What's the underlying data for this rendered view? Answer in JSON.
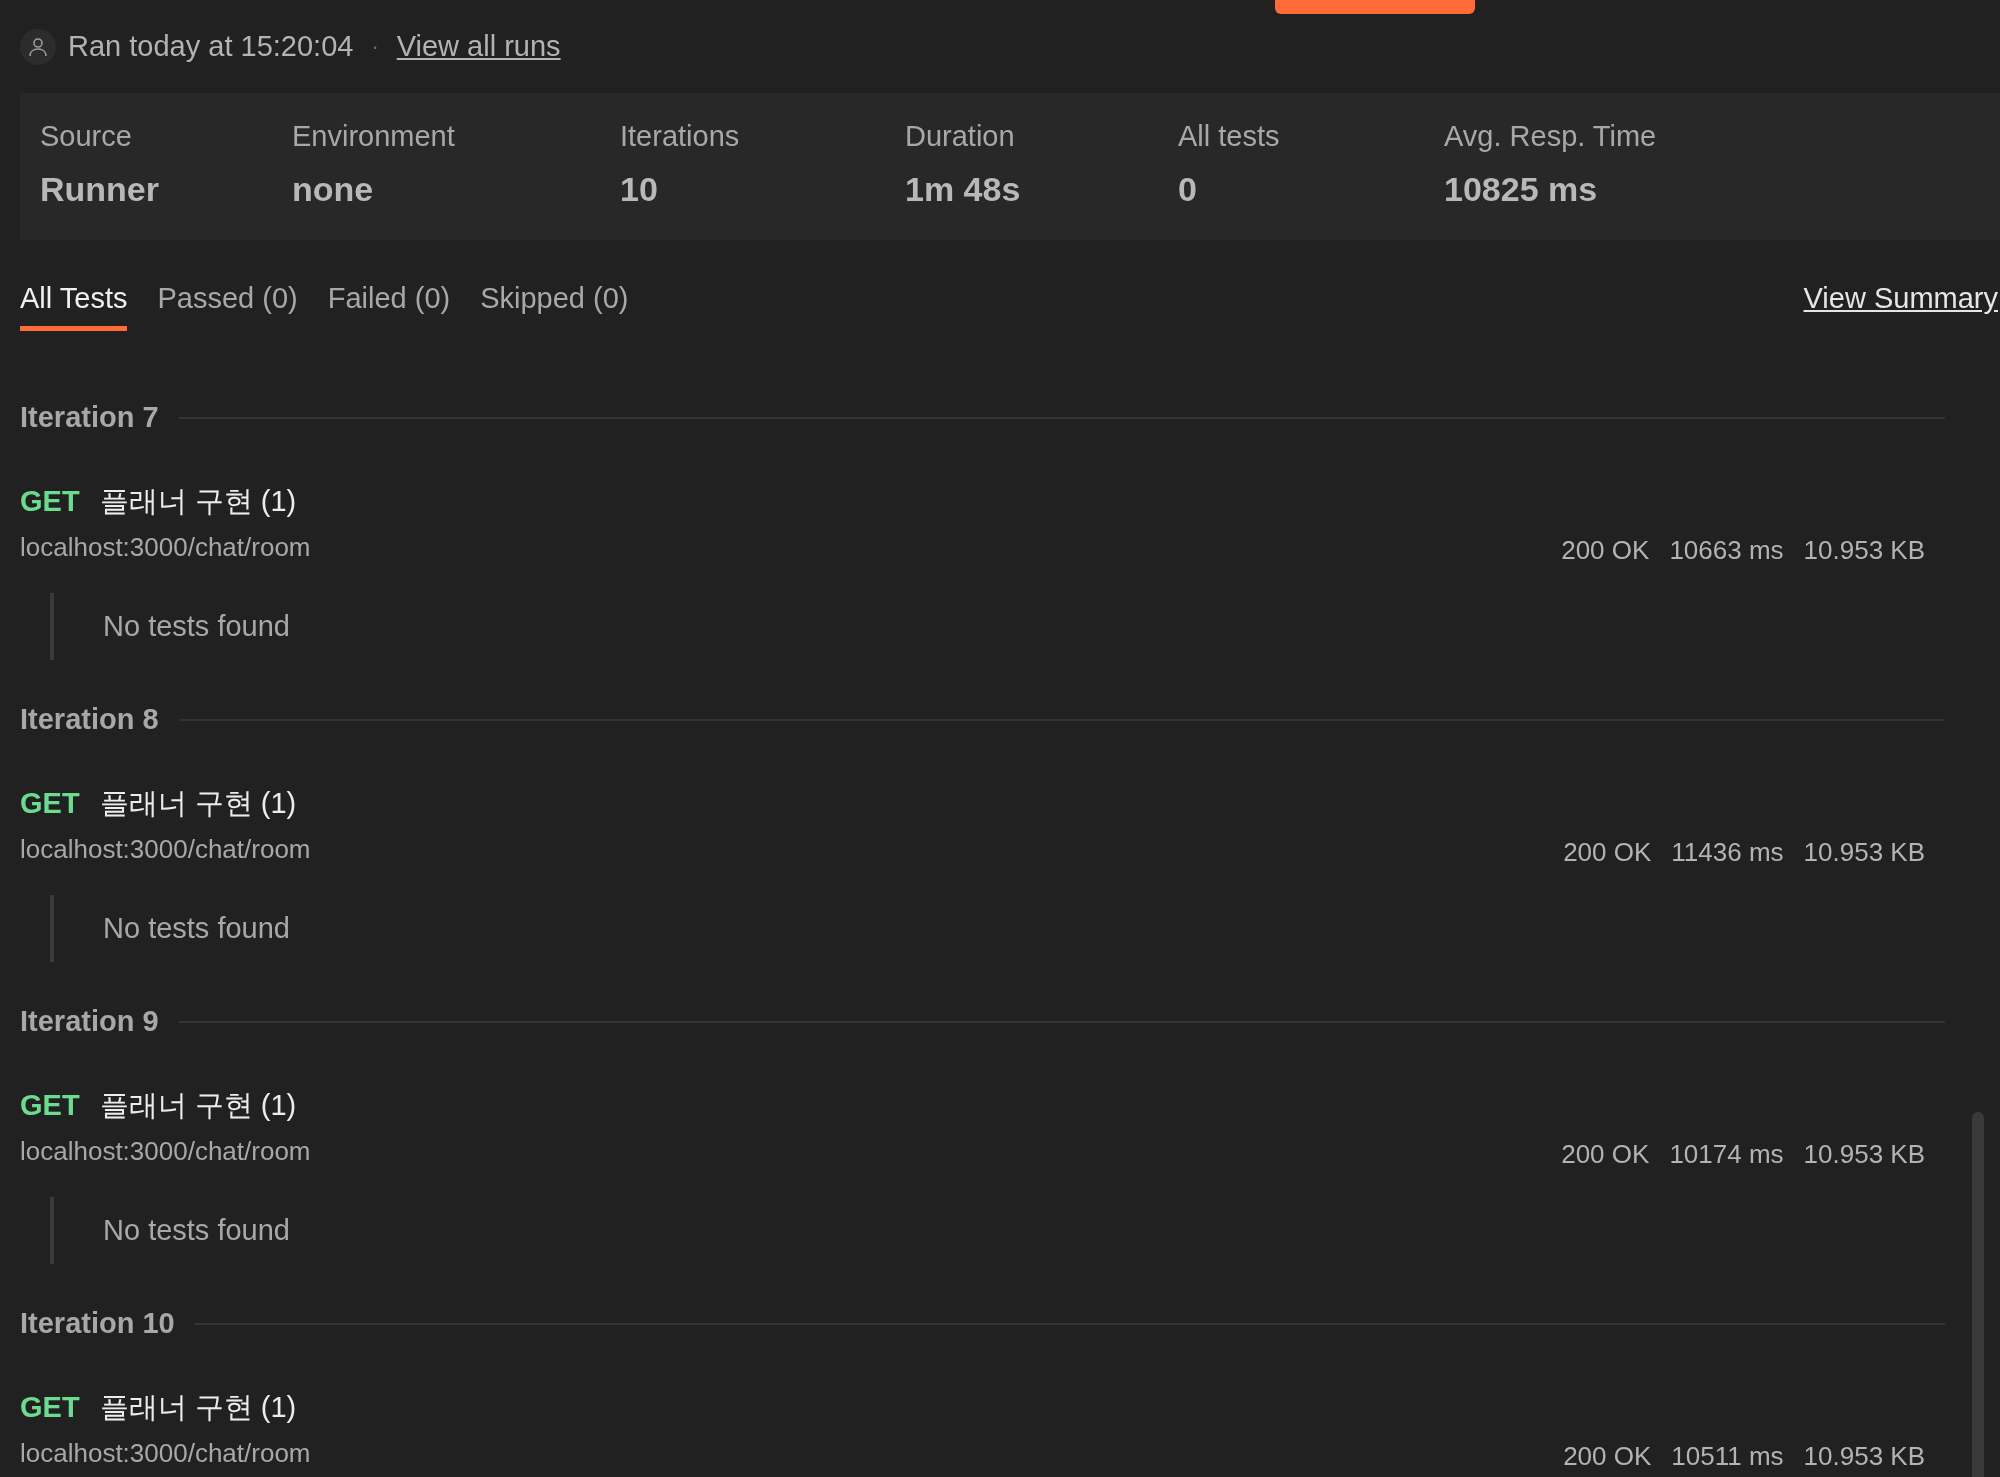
{
  "run": {
    "text": "Ran today at 15:20:04",
    "separator": "·",
    "link": "View all runs"
  },
  "summary": [
    {
      "label": "Source",
      "value": "Runner"
    },
    {
      "label": "Environment",
      "value": "none"
    },
    {
      "label": "Iterations",
      "value": "10"
    },
    {
      "label": "Duration",
      "value": "1m 48s"
    },
    {
      "label": "All tests",
      "value": "0"
    },
    {
      "label": "Avg. Resp. Time",
      "value": "10825 ms"
    }
  ],
  "tabs": [
    {
      "label": "All Tests",
      "selected": true
    },
    {
      "label": "Passed (0)",
      "selected": false
    },
    {
      "label": "Failed (0)",
      "selected": false
    },
    {
      "label": "Skipped (0)",
      "selected": false
    }
  ],
  "view_summary": "View Summary",
  "iterations": [
    {
      "title": "Iteration 7",
      "requests": [
        {
          "method": "GET",
          "name": "플래너 구현 (1)",
          "url": "localhost:3000/chat/room",
          "status": "200 OK",
          "time": "10663 ms",
          "size": "10.953 KB",
          "tests_message": "No tests found"
        }
      ]
    },
    {
      "title": "Iteration 8",
      "requests": [
        {
          "method": "GET",
          "name": "플래너 구현 (1)",
          "url": "localhost:3000/chat/room",
          "status": "200 OK",
          "time": "11436 ms",
          "size": "10.953 KB",
          "tests_message": "No tests found"
        }
      ]
    },
    {
      "title": "Iteration 9",
      "requests": [
        {
          "method": "GET",
          "name": "플래너 구현 (1)",
          "url": "localhost:3000/chat/room",
          "status": "200 OK",
          "time": "10174 ms",
          "size": "10.953 KB",
          "tests_message": "No tests found"
        }
      ]
    },
    {
      "title": "Iteration 10",
      "requests": [
        {
          "method": "GET",
          "name": "플래너 구현 (1)",
          "url": "localhost:3000/chat/room",
          "status": "200 OK",
          "time": "10511 ms",
          "size": "10.953 KB"
        }
      ]
    }
  ]
}
